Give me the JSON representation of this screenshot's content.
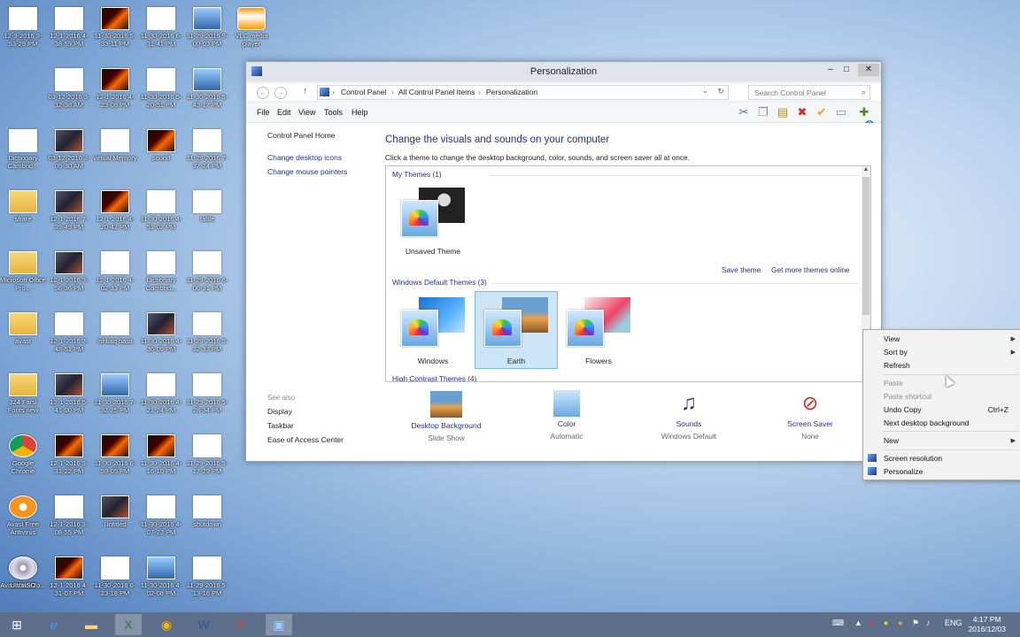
{
  "desktop_icons": [
    {
      "label": "12-3-2016 3-53-29 PM",
      "type": "doc"
    },
    {
      "label": "12-1-2016 4-38-59 PM",
      "type": "doc"
    },
    {
      "label": "11-30-2016 5-33-11 PM",
      "type": "fire"
    },
    {
      "label": "11-30-2016 6-31-41 PM",
      "type": "doc"
    },
    {
      "label": "11-29-2016 9-00-03 PM",
      "type": "sky"
    },
    {
      "label": "VLC media player",
      "type": "cone"
    },
    {
      "label": "03-12-2016 3-12-38 AM",
      "type": "doc"
    },
    {
      "label": "12-1-2016 4-23-08 PM",
      "type": "fire"
    },
    {
      "label": "11-30-2016 5-20-51 PM",
      "type": "doc"
    },
    {
      "label": "11-30-2016 5-43-17 PM",
      "type": "sky"
    },
    {
      "label": "Dictionary Cambrid...",
      "type": "red"
    },
    {
      "label": "03-12-2016 3-05-30 AM",
      "type": "img"
    },
    {
      "label": "virtual Memory",
      "type": "doc"
    },
    {
      "label": "sound",
      "type": "fire"
    },
    {
      "label": "11-29-2016 7-37-24 PM",
      "type": "doc"
    },
    {
      "label": "share",
      "type": "folder"
    },
    {
      "label": "12-1-2016 7-39-49 PM",
      "type": "img"
    },
    {
      "label": "12-1-2016 4-20-42 PM",
      "type": "fire"
    },
    {
      "label": "11-30-2016 4-51-02 PM",
      "type": "doc"
    },
    {
      "label": "table",
      "type": "doc"
    },
    {
      "label": "Microsoft Office Pro...",
      "type": "folder"
    },
    {
      "label": "12-1-2016 3-58-36 PM",
      "type": "img"
    },
    {
      "label": "12-1-2016 4-02-33 PM",
      "type": "doc"
    },
    {
      "label": "Dictionary Cambrid...",
      "type": "red"
    },
    {
      "label": "11-29-2016 6-06-31 PM",
      "type": "doc"
    },
    {
      "label": "avast",
      "type": "folder"
    },
    {
      "label": "12-1-2016 3-48-51 PM",
      "type": "doc"
    },
    {
      "label": "ishtiaq basit",
      "type": "doc"
    },
    {
      "label": "11-30-2016 4-36-09 PM",
      "type": "img"
    },
    {
      "label": "11-29-2016 5-32-33 PM",
      "type": "doc"
    },
    {
      "label": "324 Farsi Fonts new",
      "type": "folder"
    },
    {
      "label": "12-1-2016 5-41-00 PM",
      "type": "img"
    },
    {
      "label": "11-30-2016 7-32-25 PM",
      "type": "sky"
    },
    {
      "label": "11-30-2016 4-21-24 PM",
      "type": "doc"
    },
    {
      "label": "11-29-2016 5-28-34 PM",
      "type": "doc"
    },
    {
      "label": "Google Chrome",
      "type": "chrome"
    },
    {
      "label": "12-1-2016 3-31-22 PM",
      "type": "fire"
    },
    {
      "label": "11-30-2016 6-59-05 PM",
      "type": "fire"
    },
    {
      "label": "11-30-2016 4-16-10 PM",
      "type": "fire"
    },
    {
      "label": "11-29-2016 5-17-29 PM",
      "type": "doc"
    },
    {
      "label": "Avast Free Antivirus",
      "type": "orange"
    },
    {
      "label": "12-1-2016 3-08-55 PM",
      "type": "doc"
    },
    {
      "label": "Untitled",
      "type": "img"
    },
    {
      "label": "11-30-2016 4-07-23 PM",
      "type": "doc"
    },
    {
      "label": "shutdown",
      "type": "red"
    },
    {
      "label": "Avast SafeZo...",
      "type": "orange"
    },
    {
      "label": "12-1-2016 4-31-07 PM",
      "type": "fire"
    },
    {
      "label": "11-30-2016 6-23-18 PM",
      "type": "doc"
    },
    {
      "label": "11-30-2016 4-02-08 PM",
      "type": "sky"
    },
    {
      "label": "11-29-2016 5-13-16 PM",
      "type": "doc"
    },
    {
      "label": "UltraISO",
      "type": "cd"
    }
  ],
  "window": {
    "title": "Personalization",
    "min": "–",
    "max": "□",
    "close": "✕",
    "address": {
      "crumbs": [
        "Control Panel",
        "All Control Panel Items",
        "Personalization"
      ],
      "sep": "›"
    },
    "search_placeholder": "Search Control Panel",
    "menu": [
      "File",
      "Edit",
      "View",
      "Tools",
      "Help"
    ]
  },
  "sidebar": {
    "home": "Control Panel Home",
    "links": [
      "Change desktop icons",
      "Change mouse pointers"
    ],
    "see_also_title": "See also",
    "see_also": [
      "Display",
      "Taskbar",
      "Ease of Access Center"
    ]
  },
  "main": {
    "heading": "Change the visuals and sounds on your computer",
    "subheading": "Click a theme to change the desktop background, color, sounds, and screen saver all at once.",
    "my_themes_label": "My Themes (1)",
    "my_themes": [
      {
        "name": "Unsaved Theme"
      }
    ],
    "save_theme": "Save theme",
    "get_more": "Get more themes online",
    "default_themes_label": "Windows Default Themes (3)",
    "default_themes": [
      {
        "name": "Windows"
      },
      {
        "name": "Earth"
      },
      {
        "name": "Flowers"
      }
    ],
    "high_contrast_label": "High Contrast Themes (4)"
  },
  "bottom_bar": [
    {
      "name": "Desktop Background",
      "value": "Slide Show"
    },
    {
      "name": "Color",
      "value": "Automatic"
    },
    {
      "name": "Sounds",
      "value": "Windows Default"
    },
    {
      "name": "Screen Saver",
      "value": "None"
    }
  ],
  "context_menu": {
    "items": [
      {
        "label": "View",
        "submenu": true,
        "enabled": true
      },
      {
        "label": "Sort by",
        "submenu": true,
        "enabled": true
      },
      {
        "label": "Refresh",
        "enabled": true
      },
      {
        "label": "Paste",
        "enabled": false
      },
      {
        "label": "Paste shortcut",
        "enabled": false
      },
      {
        "label": "Undo Copy",
        "shortcut": "Ctrl+Z",
        "enabled": true
      },
      {
        "label": "Next desktop background",
        "enabled": true
      },
      {
        "label": "New",
        "submenu": true,
        "enabled": true
      },
      {
        "label": "Screen resolution",
        "enabled": true,
        "icon": true
      },
      {
        "label": "Personalize",
        "enabled": true,
        "icon": true
      }
    ]
  },
  "taskbar": {
    "language": "ENG",
    "time": "4:17 PM",
    "date": "2016/12/03"
  }
}
